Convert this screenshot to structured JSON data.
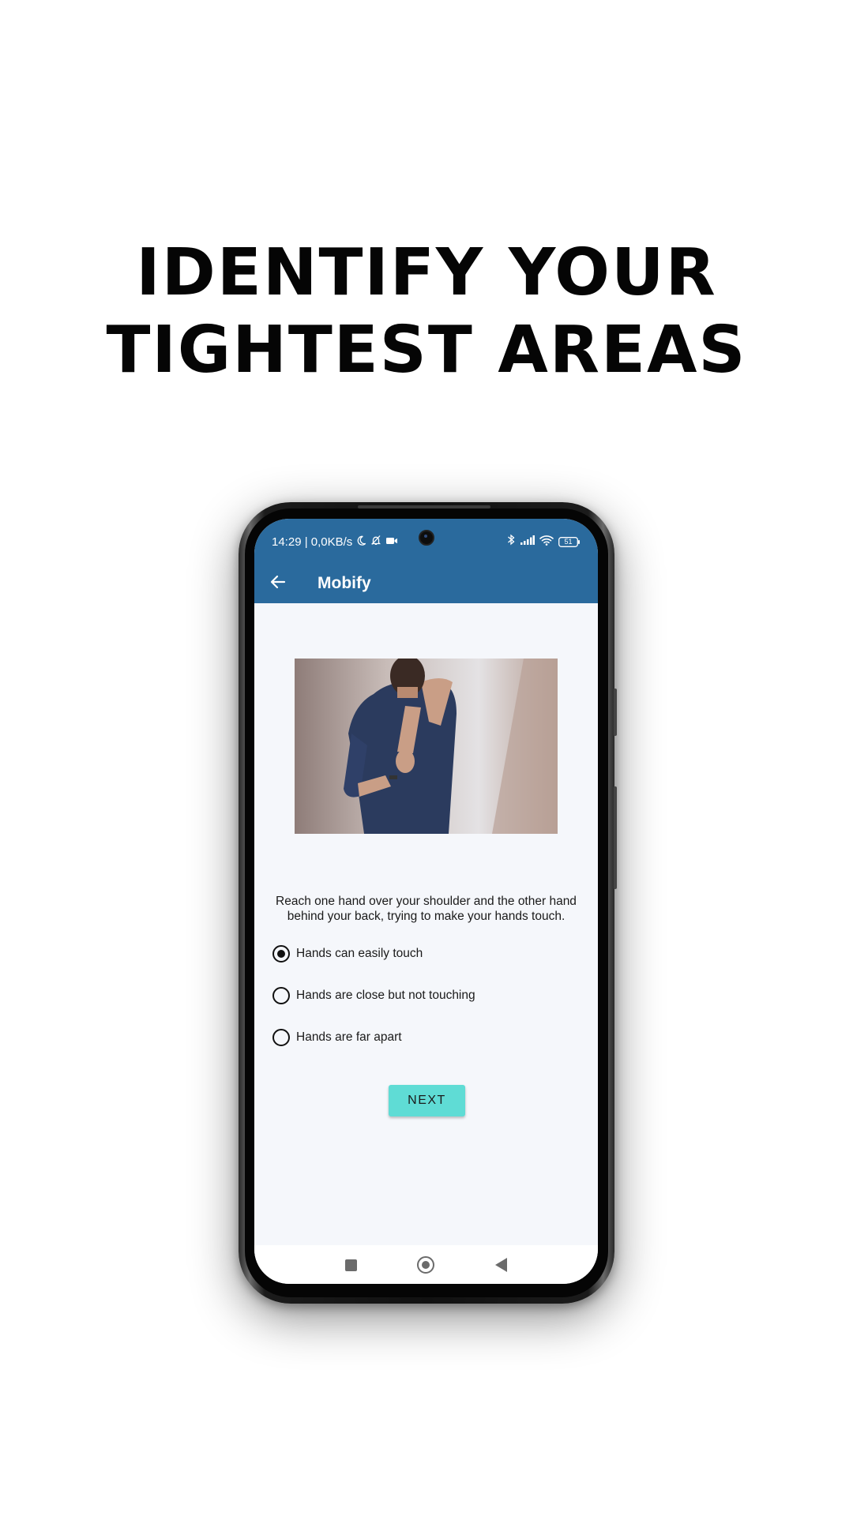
{
  "headline": {
    "line1": "IDENTIFY YOUR",
    "line2": "TIGHTEST AREAS"
  },
  "status_bar": {
    "time_and_speed": "14:29 | 0,0KB/s",
    "battery": "51",
    "left_icons": [
      "moon-icon",
      "bell-off-icon",
      "video-icon"
    ],
    "right_icons": [
      "bluetooth-icon",
      "signal-icon",
      "wifi-icon",
      "battery-icon"
    ]
  },
  "app_bar": {
    "title": "Mobify",
    "back_icon": "arrow-left-icon"
  },
  "content": {
    "instruction": "Reach one hand over your shoulder and the other hand behind your back, trying to make your hands touch.",
    "options": [
      {
        "label": "Hands can easily touch",
        "selected": true
      },
      {
        "label": "Hands are close but not touching",
        "selected": false
      },
      {
        "label": "Hands are far apart",
        "selected": false
      }
    ],
    "next_label": "NEXT"
  },
  "colors": {
    "app_bar": "#2a6a9d",
    "accent_button": "#5fdcd5",
    "screen_background": "#f5f7fb"
  }
}
